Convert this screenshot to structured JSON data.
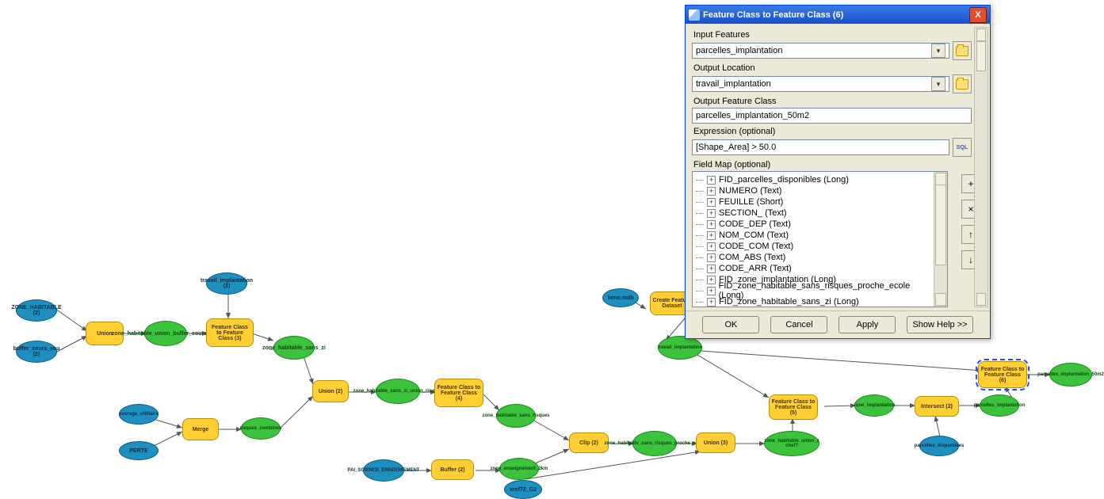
{
  "dialog": {
    "title": "Feature Class to Feature Class (6)",
    "close_glyph": "X",
    "input_features_label": "Input Features",
    "input_features_value": "parcelles_implantation",
    "output_location_label": "Output Location",
    "output_location_value": "travail_implantation",
    "output_fc_label": "Output Feature Class",
    "output_fc_value": "parcelles_implantation_50m2",
    "expression_label": "Expression (optional)",
    "expression_value": "[Shape_Area] > 50.0",
    "fieldmap_label": "Field Map (optional)",
    "sql_text": "SQL",
    "tree": [
      "FID_parcelles_disponibles (Long)",
      "NUMERO (Text)",
      "FEUILLE (Short)",
      "SECTION_ (Text)",
      "CODE_DEP (Text)",
      "NOM_COM (Text)",
      "CODE_COM (Text)",
      "COM_ABS (Text)",
      "CODE_ARR (Text)",
      "FID_zone_implantation (Long)",
      "FID_zone_habitable_sans_risques_proche_ecole (Long)",
      "FID_zone_habitable_sans_zi (Long)"
    ],
    "side_tool_add": "+",
    "side_tool_remove": "×",
    "side_tool_up": "↑",
    "side_tool_down": "↓",
    "footer": {
      "ok": "OK",
      "cancel": "Cancel",
      "apply": "Apply",
      "help": "Show Help >>"
    },
    "combo_drop_glyph": "▾"
  },
  "model": {
    "nodes": {
      "zone_habit": "ZONE_HABITABLE (2)",
      "buffer_cours": "buffer_cours_eau (2)",
      "union1": "Union",
      "zh_union_buf": "zone_habitable_union_buffer_cours_eau",
      "travail_imp2": "travail_implantation (2)",
      "fc2fc_3": "Feature Class to Feature Class (3)",
      "zh_sans_zi": "zone_habitable_sans_zi",
      "union2": "Union (2)",
      "zh_zi_union": "zone_habitable_sans_zi_union_risques",
      "fc2fc_4": "Feature Class to Feature Class (4)",
      "zh_sans_r": "zone_habitable_sans_risques",
      "ouvrage": "ouvrage_utilitaire",
      "perte": "PERTE",
      "merge": "Merge",
      "risques": "risques_combines",
      "pai_sci": "PAI_SCIENCE_ENSEIGNEMENT",
      "buffer2": "Buffer (2)",
      "ens_2km": "zone_enseignement_2km",
      "clip2": "Clip (2)",
      "zh_proche": "zone_habitable_sans_risques_proche_ecole",
      "union3": "Union (3)",
      "xref72": "xref72_G2",
      "zh_union_z": "zone_habitable_union_z chef?",
      "bene_mdb": "bene.mdb",
      "createfd": "Create Feature Dataset",
      "travail_imp": "travail_implantation",
      "fc2fc_5": "Feature Class to Feature Class (5)",
      "zone_impl": "zone_implantation",
      "intersect2": "Intersect (2)",
      "parc_impl": "parcelles_implantation",
      "parc_disp": "parcelles_disponibles",
      "fc2fc_6": "Feature Class to Feature Class (6)",
      "parc_impl50": "parcelles_implantation_50m2"
    }
  }
}
